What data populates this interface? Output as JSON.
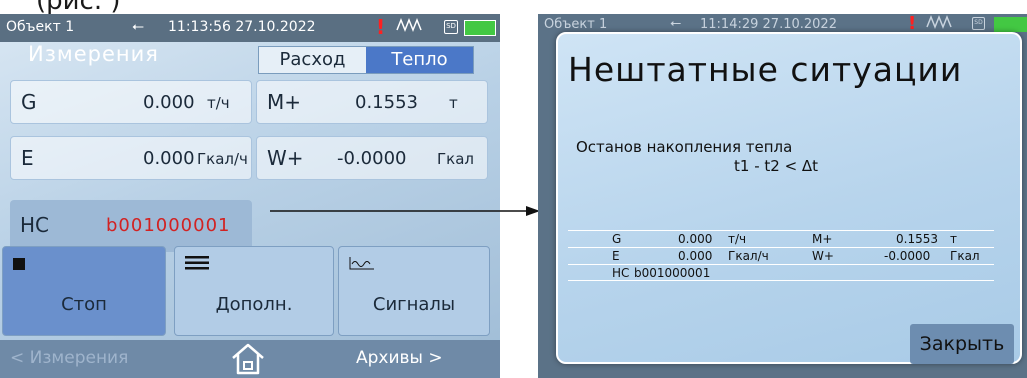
{
  "caption": "(рис. )",
  "left_screen": {
    "status": {
      "object": "Объект 1",
      "usb_icon": "usb-icon",
      "time": "11:13:56",
      "date": "27.10.2022",
      "alarm": "!",
      "sd_icon": "sd-card-icon",
      "sd_label": "SD",
      "battery_icon": "battery-icon"
    },
    "title": "Измерения",
    "tabs": [
      {
        "label": "Расход",
        "active": false
      },
      {
        "label": "Тепло",
        "active": true
      }
    ],
    "values": {
      "G": {
        "label": "G",
        "value": "0.000",
        "unit": "т/ч"
      },
      "M": {
        "label": "M+",
        "value": "0.1553",
        "unit": "т"
      },
      "E": {
        "label": "E",
        "value": "0.000",
        "unit": "Гкал/ч"
      },
      "W": {
        "label": "W+",
        "value": "-0.0000",
        "unit": "Гкал"
      }
    },
    "hc": {
      "label": "НС",
      "code": "b001000001"
    },
    "buttons": [
      {
        "label": "Стоп",
        "icon": "stop-icon"
      },
      {
        "label": "Дополн.",
        "icon": "menu-icon"
      },
      {
        "label": "Сигналы",
        "icon": "signal-wave-icon"
      }
    ],
    "nav": {
      "back": "< Измерения",
      "home_icon": "home-icon",
      "forward": "Архивы >"
    }
  },
  "right_screen": {
    "status": {
      "object": "Объект 1",
      "time": "11:14:29",
      "date": "27.10.2022",
      "alarm": "!",
      "sd_label": "SD"
    },
    "dialog": {
      "title": "Нештатные ситуации",
      "message_line1": "Останов накопления тепла",
      "message_line2": "t1 - t2 < Δt",
      "table": {
        "row1": {
          "c1": "G",
          "c2": "0.000",
          "c3": "т/ч",
          "c4": "M+",
          "c5": "0.1553",
          "c6": "т"
        },
        "row2": {
          "c1": "E",
          "c2": "0.000",
          "c3": "Гкал/ч",
          "c4": "W+",
          "c5": "-0.0000",
          "c6": "Гкал"
        },
        "row3": {
          "c1": "НС",
          "c2": "b001000001"
        }
      },
      "close_label": "Закрыть"
    }
  },
  "colors": {
    "alarm": "#ff2020",
    "hc_code": "#d22222",
    "active_tab": "#4b78c8",
    "battery": "#43c843"
  }
}
